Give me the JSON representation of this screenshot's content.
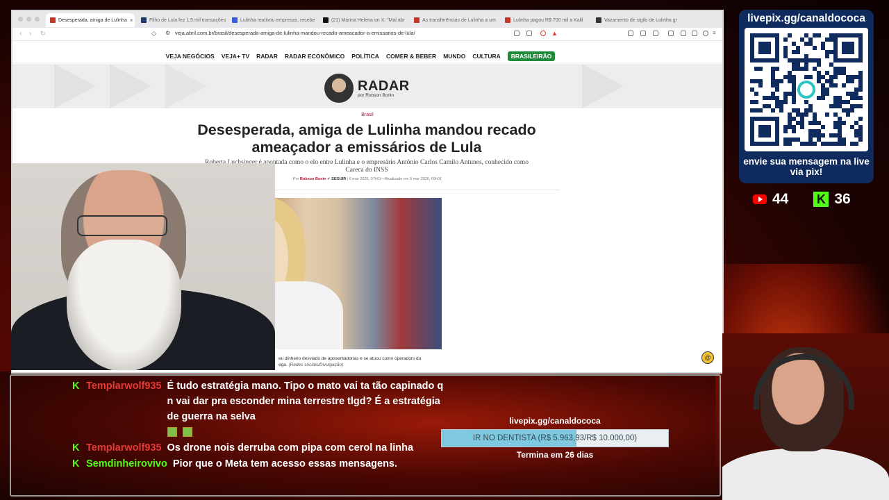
{
  "browser": {
    "tabs": [
      {
        "label": "Desesperada, amiga de Lulinha",
        "color": "#c0392b",
        "active": true
      },
      {
        "label": "Filho de Lula fez 1,5 mil transações",
        "color": "#1a3a6c",
        "active": false
      },
      {
        "label": "Lulinha reativou empresas, recebe",
        "color": "#3b5bdb",
        "active": false
      },
      {
        "label": "(21) Marina Helena on X: \"Mal abr",
        "color": "#111111",
        "active": false
      },
      {
        "label": "As transferências de Lulinha a um",
        "color": "#c0392b",
        "active": false
      },
      {
        "label": "Lulinha pagou R$ 700 mil a Kalil",
        "color": "#c0392b",
        "active": false
      },
      {
        "label": "Vazamento de sigilo de Lulinha gr",
        "color": "#333333",
        "active": false
      }
    ],
    "url": "veja.abril.com.br/brasil/desesperada-amiga-de-lulinha-mandou-recado-ameacador-a-emissarios-de-lula/"
  },
  "site": {
    "nav": [
      "VEJA NEGÓCIOS",
      "VEJA+ TV",
      "RADAR",
      "RADAR ECONÔMICO",
      "POLÍTICA",
      "COMER & BEBER",
      "MUNDO",
      "CULTURA"
    ],
    "nav_highlight": "BRASILEIRÃO",
    "column_name": "RADAR",
    "column_author": "por Robson Bonin"
  },
  "article": {
    "kicker": "Brasil",
    "headline": "Desesperada, amiga de Lulinha mandou recado ameaçador a emissários de Lula",
    "subhead": "Roberta Luchsinger é apontada como o elo entre Lulinha e o empresário Antônio Carlos Camilo Antunes, conhecido como Careca do INSS",
    "byline_prefix": "Por",
    "author": "Robson Bonin",
    "follow": "SEGUIR",
    "dates": "| 6 mar 2026, 07h01 • Atualizado em 6 mar 2026, 09h01",
    "caption_line1": "eu dinheiro desviado de aposentadorias e se atuou como operadors do",
    "caption_line2": "ega.",
    "caption_credit": "(Redes sociais/Divulgação)"
  },
  "overlay": {
    "livepix_url": "livepix.gg/canaldococa",
    "livepix_message": "envie sua mensagem na live via pix!",
    "youtube_count": "44",
    "kick_count": "36",
    "kick_letter": "K"
  },
  "chat": [
    {
      "user": "Templarwolf935",
      "user_color": "red",
      "text": "É tudo estratégia mano. Tipo o mato vai ta tão capinado q n vai dar pra esconder mina terrestre tlgd? É a estratégia de guerra na selva",
      "emojis": 2
    },
    {
      "user": "Templarwolf935",
      "user_color": "red",
      "text": "Os drone nois derruba com pipa com cerol na linha",
      "emojis": 0
    },
    {
      "user": "Semdinheirovivo",
      "user_color": "green",
      "text": "Pior que o Meta tem acesso essas mensagens.",
      "emojis": 0
    }
  ],
  "goal": {
    "title": "livepix.gg/canaldococa",
    "label": "IR NO DENTISTA (R$ 5.963,93/R$ 10.000,00)",
    "progress": 0.596,
    "ends": "Termina em 26 dias"
  }
}
